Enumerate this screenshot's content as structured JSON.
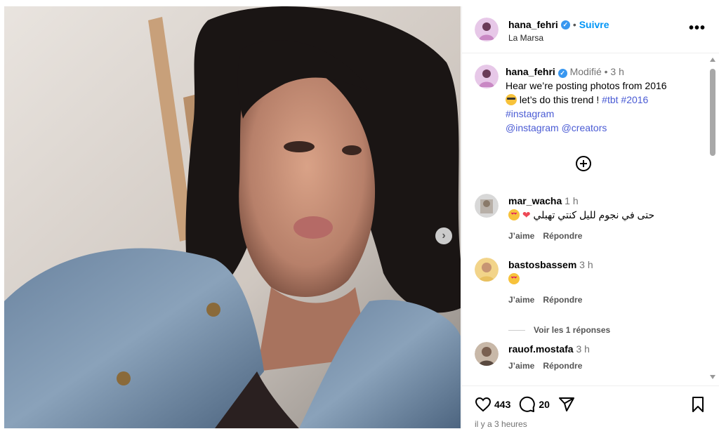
{
  "post": {
    "author": "hana_fehri",
    "follow_label": "Suivre",
    "location": "La Marsa",
    "more_label": "•••"
  },
  "caption": {
    "author": "hana_fehri",
    "edited": "Modifié",
    "time": "3 h",
    "line1": "Hear we’re posting photos from 2016",
    "line2": "let’s do this trend !",
    "tag_tbt": "#tbt",
    "tag_2016": "#2016",
    "tag_instagram": "#instagram",
    "mention_instagram": "@instagram",
    "mention_creators": "@creators"
  },
  "comments": [
    {
      "user": "mar_wacha",
      "time": "1 h",
      "text": "حتى في نجوم لليل كنتي تهبلي",
      "like_label": "J’aime",
      "reply_label": "Répondre"
    },
    {
      "user": "bastosbassem",
      "time": "3 h",
      "text": "",
      "like_label": "J’aime",
      "reply_label": "Répondre",
      "view_replies": "Voir les 1 réponses"
    },
    {
      "user": "rauof.mostafa",
      "time": "3 h",
      "text": "",
      "like_label": "J’aime",
      "reply_label": "Répondre"
    }
  ],
  "actions": {
    "likes": "443",
    "comments": "20",
    "posted": "il y a 3 heures"
  },
  "colors": {
    "link": "#0095f6",
    "hashtag": "#4a5bd4",
    "verified": "#3897f0",
    "heart": "#ed4956"
  }
}
